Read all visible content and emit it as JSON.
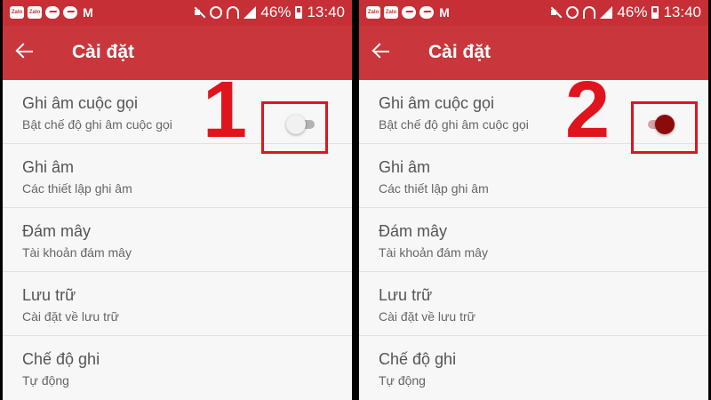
{
  "panels": [
    {
      "status": {
        "battery": "46%",
        "time": "13:40",
        "zalo_label": "Zalo"
      },
      "app_bar": {
        "title": "Cài đặt"
      },
      "items": [
        {
          "title": "Ghi âm cuộc gọi",
          "subtitle": "Bật chế độ ghi âm cuộc gọi",
          "toggle": "off"
        },
        {
          "title": "Ghi âm",
          "subtitle": "Các thiết lập ghi âm"
        },
        {
          "title": "Đám mây",
          "subtitle": "Tài khoản đám mây"
        },
        {
          "title": "Lưu trữ",
          "subtitle": "Cài đặt về lưu trữ"
        },
        {
          "title": "Chế độ ghi",
          "subtitle": "Tự động"
        }
      ],
      "step_number": "1"
    },
    {
      "status": {
        "battery": "46%",
        "time": "13:40",
        "zalo_label": "Zalo"
      },
      "app_bar": {
        "title": "Cài đặt"
      },
      "items": [
        {
          "title": "Ghi âm cuộc gọi",
          "subtitle": "Bật chế độ ghi âm cuộc gọi",
          "toggle": "on"
        },
        {
          "title": "Ghi âm",
          "subtitle": "Các thiết lập ghi âm"
        },
        {
          "title": "Đám mây",
          "subtitle": "Tài khoản đám mây"
        },
        {
          "title": "Lưu trữ",
          "subtitle": "Cài đặt về lưu trữ"
        },
        {
          "title": "Chế độ ghi",
          "subtitle": "Tự động"
        }
      ],
      "step_number": "2"
    }
  ],
  "colors": {
    "status_bar": "#c62f35",
    "app_bar": "#c9373c",
    "highlight": "#e0141d",
    "toggle_on": "#8b0b0b"
  }
}
